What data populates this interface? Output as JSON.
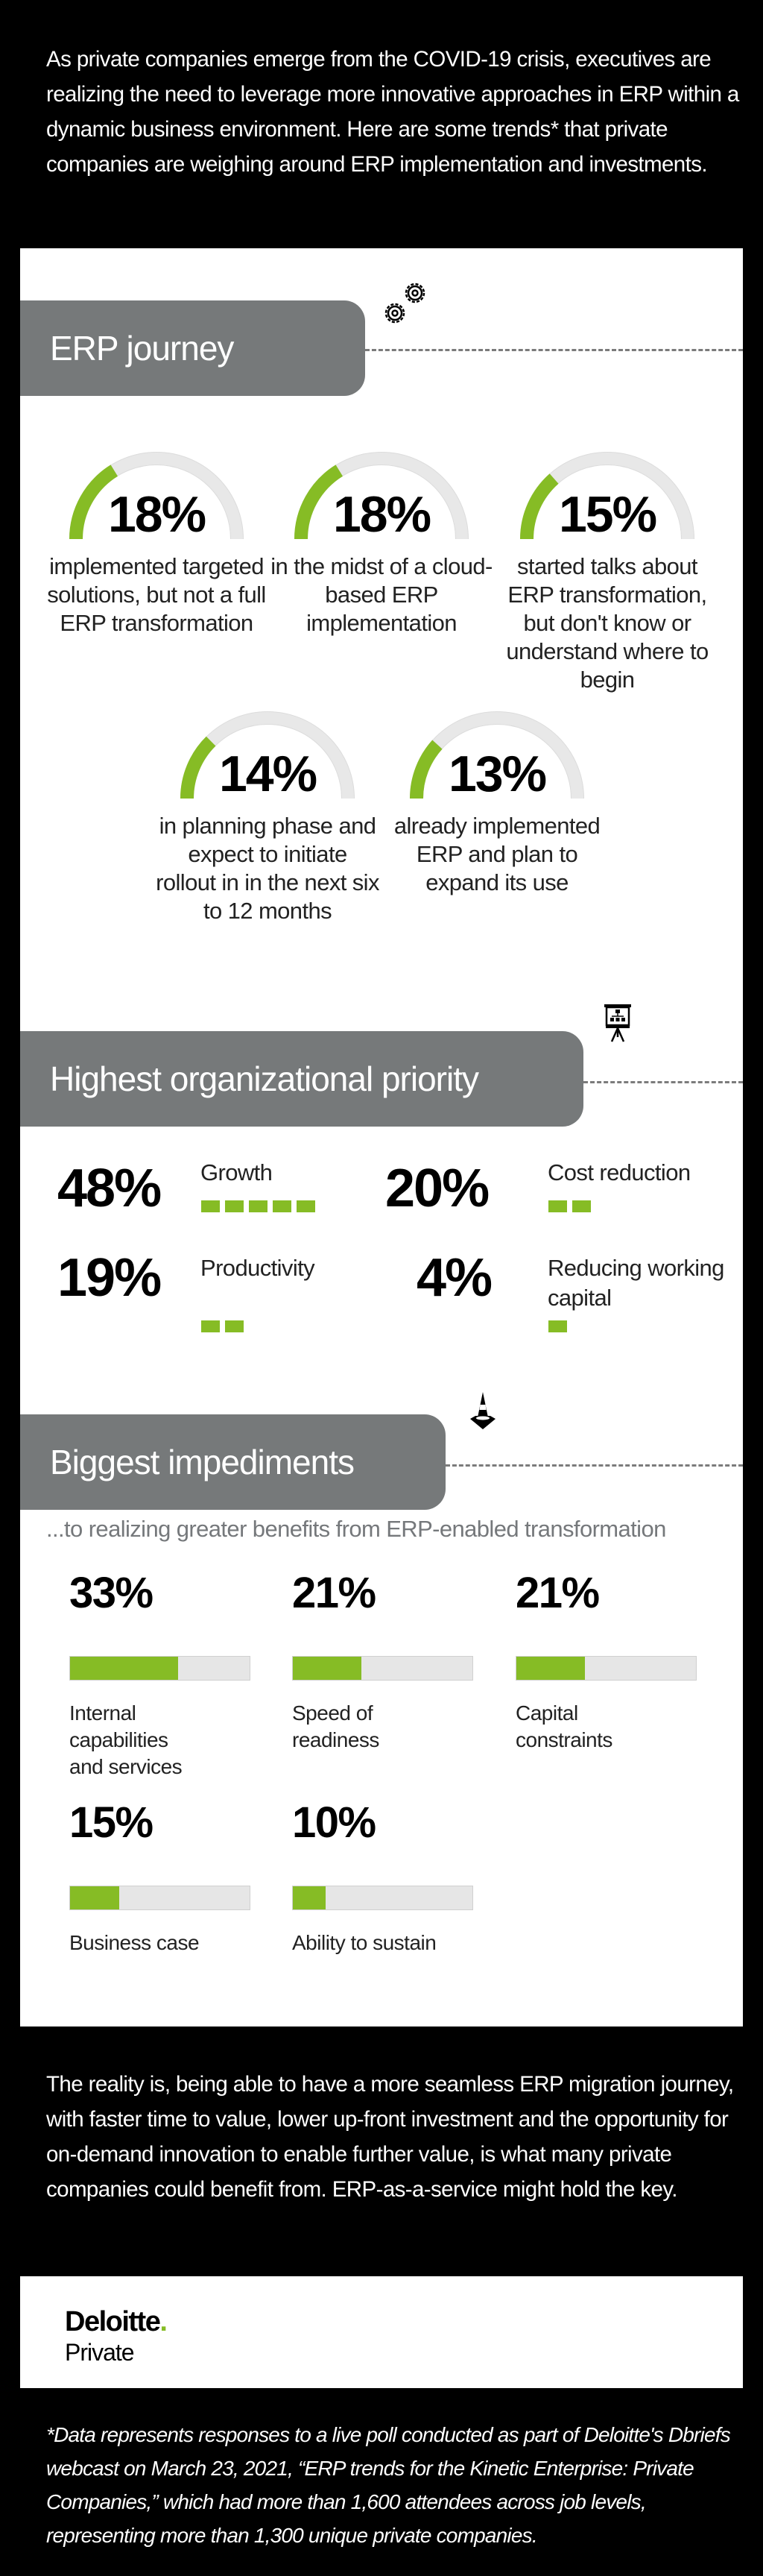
{
  "intro": "As private companies emerge from the COVID-19 crisis, executives are realizing the need to leverage more innovative approaches in ERP within a dynamic business environment. Here are some trends* that private companies are weighing around ERP implementation and investments.",
  "colors": {
    "accent": "#86bc25",
    "track": "#e6e6e6",
    "tab": "#76797a"
  },
  "erp_journey": {
    "title": "ERP journey",
    "icon": "gears-icon",
    "gauges": [
      {
        "value": 18,
        "label": "18%",
        "desc": "implemented targeted solutions, but not a full ERP transformation"
      },
      {
        "value": 18,
        "label": "18%",
        "desc": "in the midst of a cloud-based ERP implementation"
      },
      {
        "value": 15,
        "label": "15%",
        "desc": "started talks about ERP transformation, but don't know or understand where to begin"
      },
      {
        "value": 14,
        "label": "14%",
        "desc": "in planning phase and expect to initiate rollout in in the next six to 12 months"
      },
      {
        "value": 13,
        "label": "13%",
        "desc": "already implemented ERP and plan to expand its use"
      }
    ]
  },
  "priority": {
    "title": "Highest organizational priority",
    "icon": "presentation-board-icon",
    "items": [
      {
        "value": 48,
        "label": "48%",
        "name": "Growth",
        "squares": 5
      },
      {
        "value": 20,
        "label": "20%",
        "name": "Cost reduction",
        "squares": 2
      },
      {
        "value": 19,
        "label": "19%",
        "name": "Productivity",
        "squares": 2
      },
      {
        "value": 4,
        "label": "4%",
        "name": "Reducing working capital",
        "squares": 1
      }
    ]
  },
  "impediments": {
    "title": "Biggest impediments",
    "icon": "traffic-cone-icon",
    "subtitle": "...to realizing greater benefits from ERP-enabled transformation",
    "items": [
      {
        "value": 33,
        "label": "33%",
        "name": "Internal capabilities and services"
      },
      {
        "value": 21,
        "label": "21%",
        "name": "Speed of readiness"
      },
      {
        "value": 21,
        "label": "21%",
        "name": "Capital constraints"
      },
      {
        "value": 15,
        "label": "15%",
        "name": "Business case"
      },
      {
        "value": 10,
        "label": "10%",
        "name": "Ability to sustain"
      }
    ]
  },
  "outro": "The reality is, being able to have a more seamless ERP migration journey, with faster time to value, lower up-front investment and the opportunity for on-demand innovation to enable further value, is what many private companies could benefit from. ERP-as-a-service might hold the key.",
  "logo": {
    "brand": "Deloitte",
    "dot": ".",
    "sub": "Private"
  },
  "footnote": "*Data represents responses to a live poll conducted as part of Deloitte's Dbriefs webcast on March 23, 2021, “ERP trends for the Kinetic Enterprise: Private Companies,” which had more than 1,600 attendees across job levels, representing more than 1,300 unique private companies."
}
